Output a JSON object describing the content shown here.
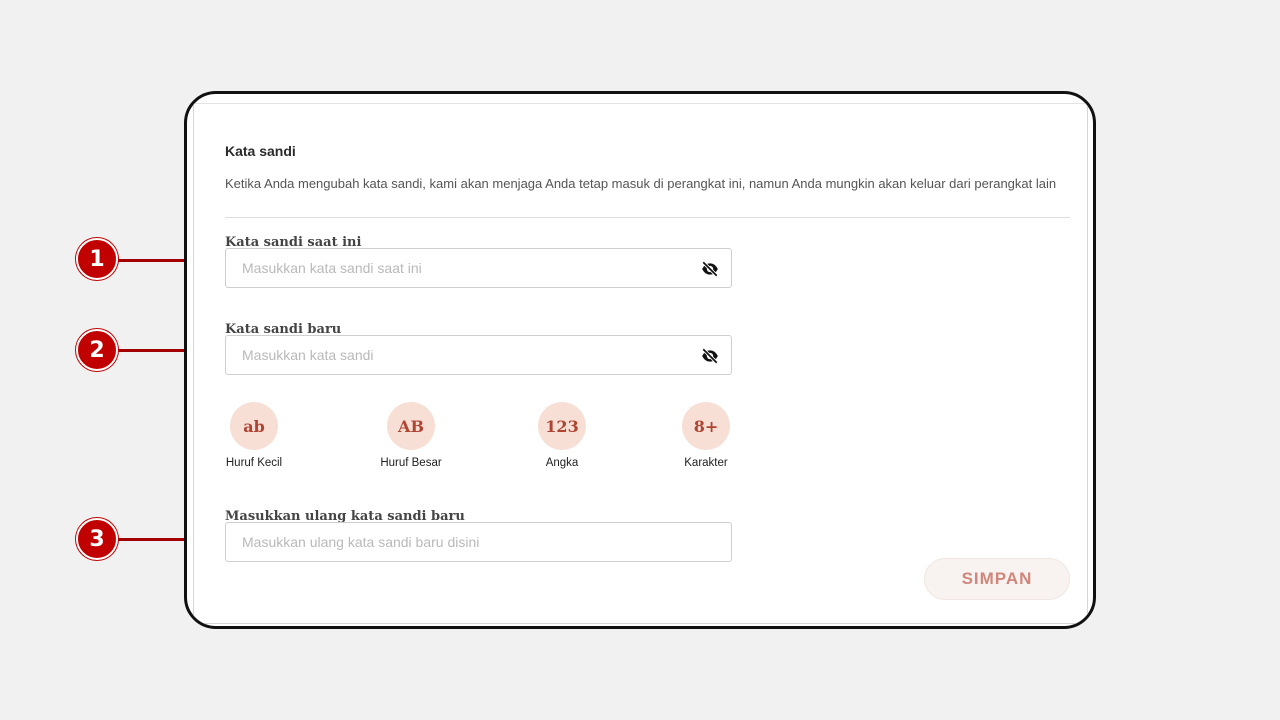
{
  "section": {
    "title": "Kata sandi",
    "description": "Ketika Anda mengubah kata sandi, kami akan menjaga Anda tetap masuk di perangkat ini, namun Anda mungkin akan keluar dari perangkat lain"
  },
  "fields": {
    "current": {
      "label": "Kata sandi saat ini",
      "placeholder": "Masukkan kata sandi saat ini",
      "value": ""
    },
    "new": {
      "label": "Kata sandi baru",
      "placeholder": "Masukkan kata sandi",
      "value": ""
    },
    "confirm": {
      "label": "Masukkan ulang kata sandi baru",
      "placeholder": "Masukkan ulang kata sandi baru disini",
      "value": ""
    }
  },
  "requirements": [
    {
      "symbol": "ab",
      "caption": "Huruf Kecil"
    },
    {
      "symbol": "AB",
      "caption": "Huruf Besar"
    },
    {
      "symbol": "123",
      "caption": "Angka"
    },
    {
      "symbol": "8+",
      "caption": "Karakter"
    }
  ],
  "save_button": {
    "label": "SIMPAN",
    "color": "#d0867a"
  },
  "annotations": [
    "1",
    "2",
    "3"
  ],
  "icons": {
    "toggle_visibility": "eye-slash-icon"
  },
  "colors": {
    "marker": "#c10000",
    "requirement_bg": "#f7dfd5",
    "requirement_text": "#b04432"
  }
}
